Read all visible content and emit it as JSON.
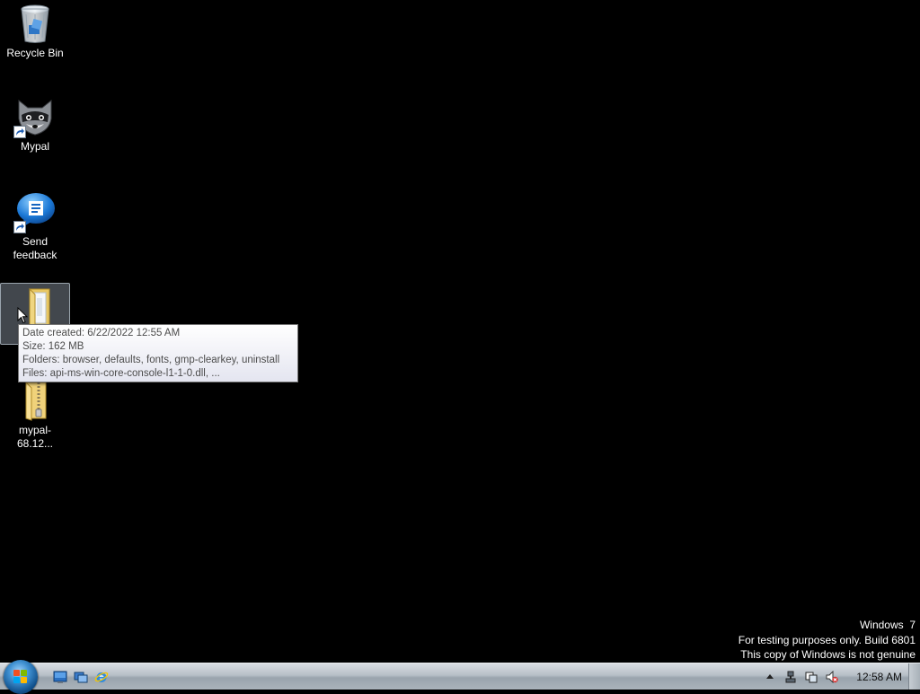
{
  "desktop": {
    "icons": [
      {
        "label": "Recycle Bin",
        "icon": "recycle-bin-icon"
      },
      {
        "label": "Mypal",
        "icon": "raccoon-icon"
      },
      {
        "label": "Send\nfeedback",
        "icon": "feedback-icon"
      },
      {
        "label": "",
        "icon": "folder-icon"
      },
      {
        "label": "mypal-68.12...",
        "icon": "zip-folder-icon"
      }
    ]
  },
  "tooltip": {
    "date_created": "Date created: 6/22/2022 12:55 AM",
    "size": "Size: 162 MB",
    "folders": "Folders: browser, defaults, fonts, gmp-clearkey, uninstall",
    "files": "Files: api-ms-win-core-console-l1-1-0.dll, ..."
  },
  "watermark": {
    "line1": "Windows  7",
    "line2": "For testing purposes only. Build 6801",
    "line3": "This copy of Windows is not genuine"
  },
  "taskbar": {
    "quick_launch": [
      "show-desktop-icon",
      "switch-windows-icon",
      "internet-explorer-icon"
    ],
    "tray_icons": [
      "chevron-up-icon",
      "network-icon",
      "action-center-icon",
      "volume-muted-icon"
    ],
    "clock": "12:58 AM"
  },
  "colors": {
    "desktop_bg": "#000000",
    "taskbar_top": "#d9dee3",
    "taskbar_bottom": "#9aa4ad",
    "tooltip_text": "#4c4c4c"
  }
}
